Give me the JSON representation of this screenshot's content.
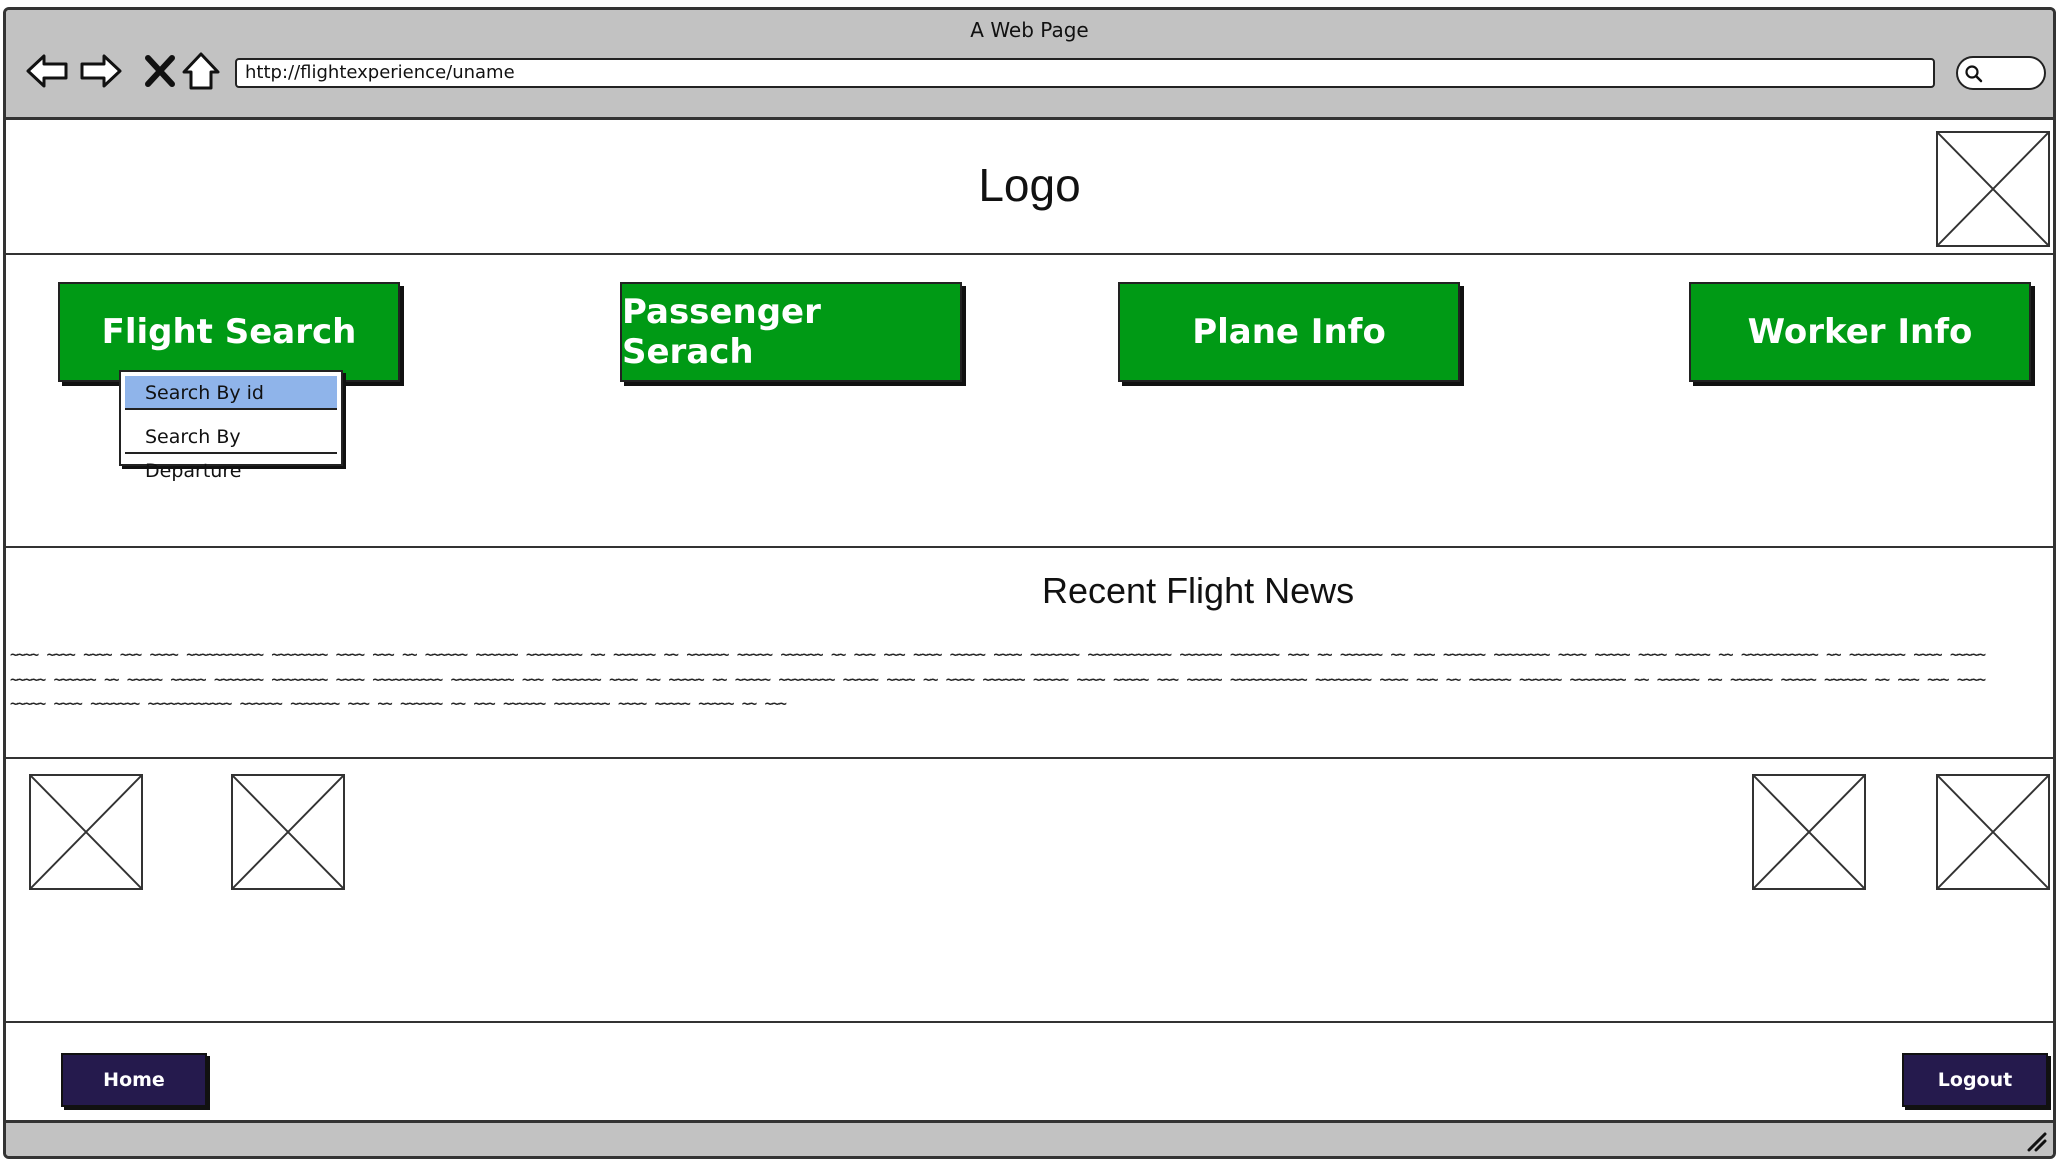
{
  "browser": {
    "title": "A Web Page",
    "url": "http://flightexperience/uname",
    "icons": [
      "back-arrow-icon",
      "forward-arrow-icon",
      "close-x-icon",
      "home-icon",
      "search-icon"
    ]
  },
  "header": {
    "logo_text": "Logo"
  },
  "nav": {
    "flight_search": "Flight Search",
    "passenger_search": "Passenger Serach",
    "plane_info": "Plane Info",
    "worker_info": "Worker Info"
  },
  "dropdown": {
    "items": [
      "Search By id",
      "Search By Departure"
    ],
    "selected": "Search By id"
  },
  "news": {
    "title": "Recent Flight News",
    "body": "~~~~ ~~~~ ~~~~ ~~~ ~~~~ ~~~~~~~~~~~ ~~~~~~~~ ~~~~ ~~~ ~~ ~~~~~~ ~~~~~~ ~~~~~~~~ ~~ ~~~~~~ ~~ ~~~~~~ ~~~~~ ~~~~~~ ~~ ~~~ ~~~ ~~~~ ~~~~~ ~~~~ ~~~~~~~ ~~~~~~~~~~~~ ~~~~~~ ~~~~~~~ ~~~ ~~ ~~~~~~ ~~ ~~~ ~~~~~~ ~~~~~~~~ ~~~~ ~~~~~ ~~~~ ~~~~~ ~~ ~~~~~~~~~~~ ~~ ~~~~~~~~ ~~~~ ~~~~~ ~~~~~ ~~~~~~ ~~ ~~~~~ ~~~~~ ~~~~~~~ ~~~~~~~~ ~~~~ ~~~~~~~~~~ ~~~~~~~~~ ~~~ ~~~~~~~ ~~~~ ~~ ~~~~~ ~~ ~~~~~ ~~~~~~~~ ~~~~~ ~~~~ ~~ ~~~~ ~~~~~~ ~~~~~ ~~~~ ~~~~~ ~~~ ~~~~~ ~~~~~~~~~~~ ~~~~~~~~ ~~~~ ~~~ ~~ ~~~~~~ ~~~~~~ ~~~~~~~~ ~~ ~~~~~~ ~~ ~~~~~~ ~~~~~ ~~~~~~ ~~ ~~~ ~~~ ~~~~ ~~~~~ ~~~~ ~~~~~~~ ~~~~~~~~~~~~ ~~~~~~ ~~~~~~~ ~~~ ~~ ~~~~~~ ~~ ~~~ ~~~~~~ ~~~~~~~~ ~~~~ ~~~~~ ~~~~~ ~~ ~~~"
  },
  "footer": {
    "home_label": "Home",
    "logout_label": "Logout"
  }
}
